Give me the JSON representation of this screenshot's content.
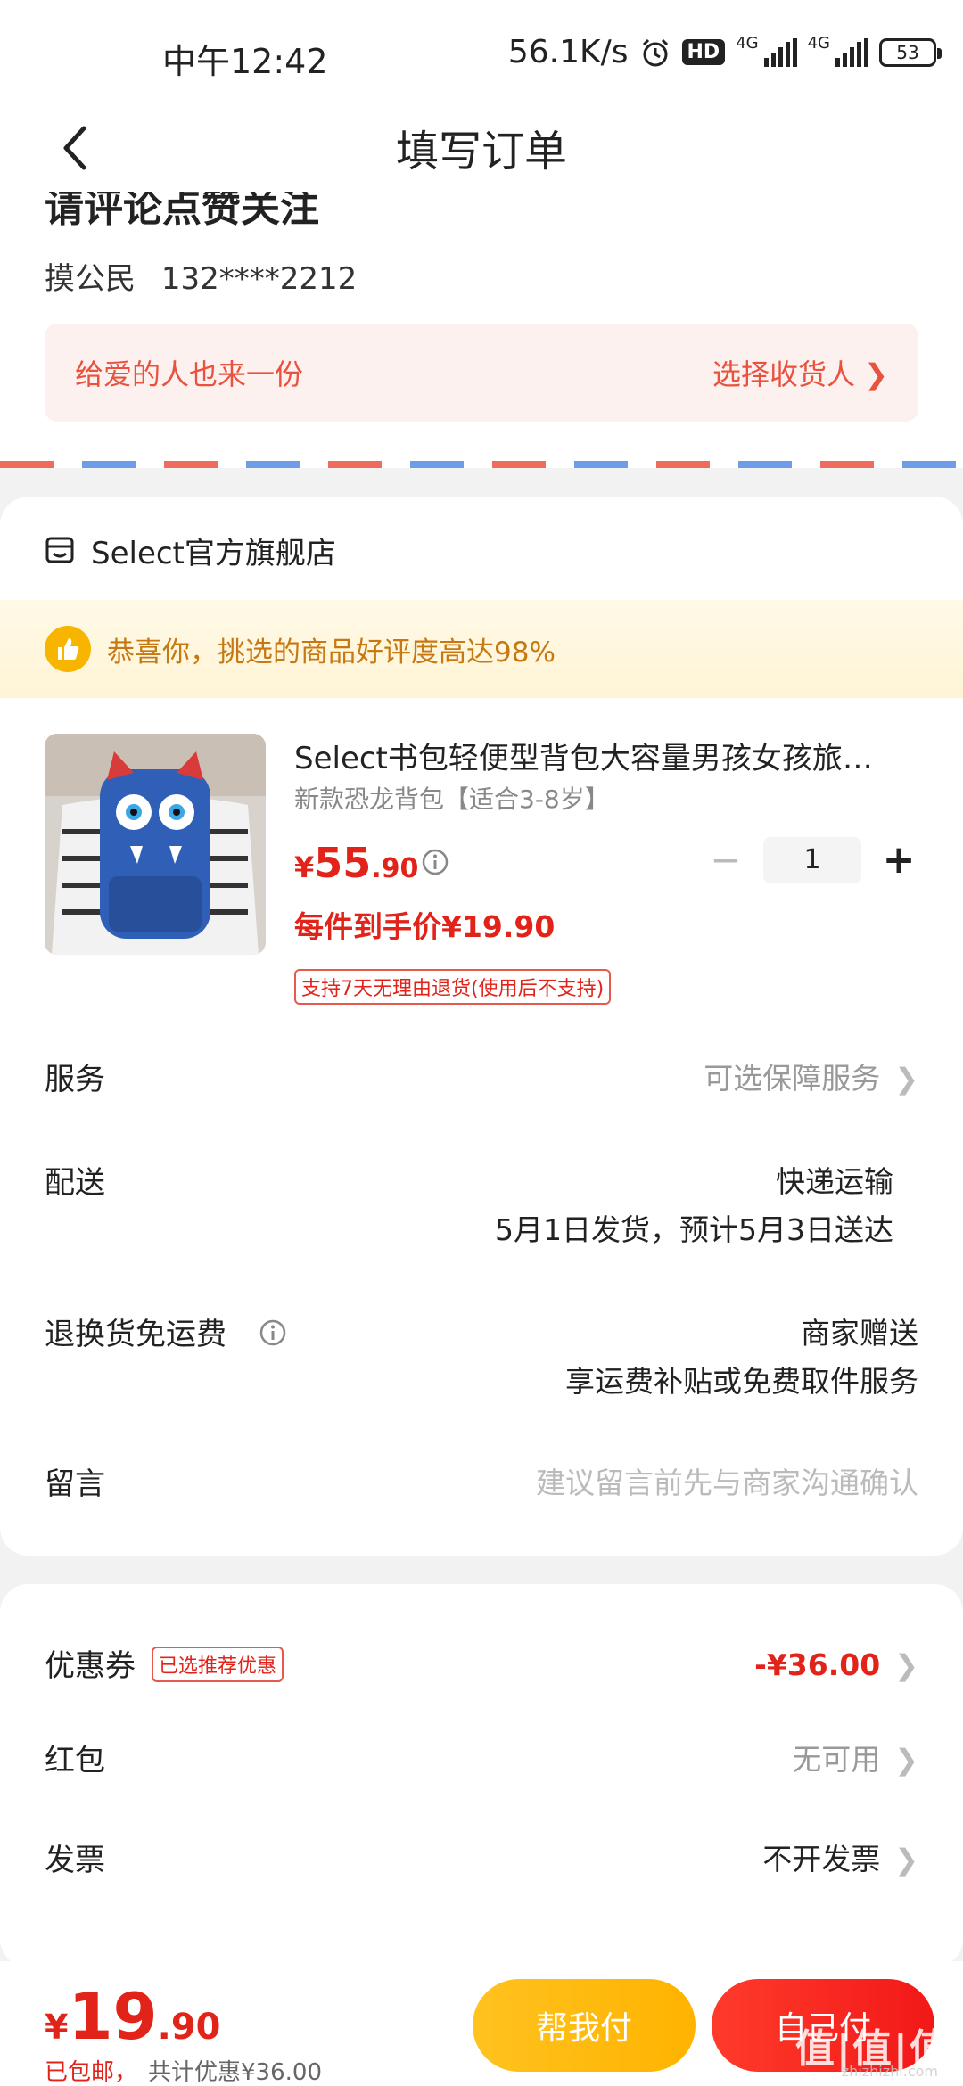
{
  "status_bar": {
    "time": "中午12:42",
    "speed": "56.1K/s",
    "hd": "HD",
    "net1": "4G",
    "net2": "4G",
    "battery": "53"
  },
  "header": {
    "title": "填写订单"
  },
  "address": {
    "title_partial": "请评论点赞关注",
    "name": "摸公民",
    "phone": "132****2212",
    "gift_left": "给爱的人也来一份",
    "gift_right": "选择收货人 ❯"
  },
  "store": {
    "name": "Select官方旗舰店"
  },
  "praise": {
    "text": "恭喜你，挑选的商品好评度高达98%"
  },
  "product": {
    "title": "Select书包轻便型背包大容量男孩女孩旅…",
    "spec": "新款恐龙背包【适合3-8岁】",
    "price_symbol": "¥",
    "price_int": "55",
    "price_dec": ".90",
    "quantity": "1",
    "minus": "−",
    "plus": "+",
    "unit_price": "每件到手价¥19.90",
    "return_tag": "支持7天无理由退货(使用后不支持)"
  },
  "rows": {
    "service_label": "服务",
    "service_value": "可选保障服务",
    "delivery_label": "配送",
    "delivery_value1": "快递运输",
    "delivery_value2": "5月1日发货，预计5月3日送达",
    "return_label": "退换货免运费",
    "return_value1": "商家赠送",
    "return_value2": "享运费补贴或免费取件服务",
    "note_label": "留言",
    "note_placeholder": "建议留言前先与商家沟通确认"
  },
  "discounts": {
    "coupon_label": "优惠券",
    "coupon_tag": "已选推荐优惠",
    "coupon_value": "-¥36.00",
    "redpack_label": "红包",
    "redpack_value": "无可用",
    "invoice_label": "发票",
    "invoice_value": "不开发票"
  },
  "bottom": {
    "total_symbol": "¥",
    "total_int": "19",
    "total_dec": ".90",
    "shipping": "已包邮，",
    "saved": "共计优惠¥36.00",
    "help_pay": "帮我付",
    "self_pay": "自己付",
    "watermark": "值|值|值",
    "watermark_url": "zhizhizhi.com"
  },
  "colors": {
    "accent_red": "#e2231a",
    "yellow_button": "#ffc21f",
    "red_button": "#f21818"
  }
}
